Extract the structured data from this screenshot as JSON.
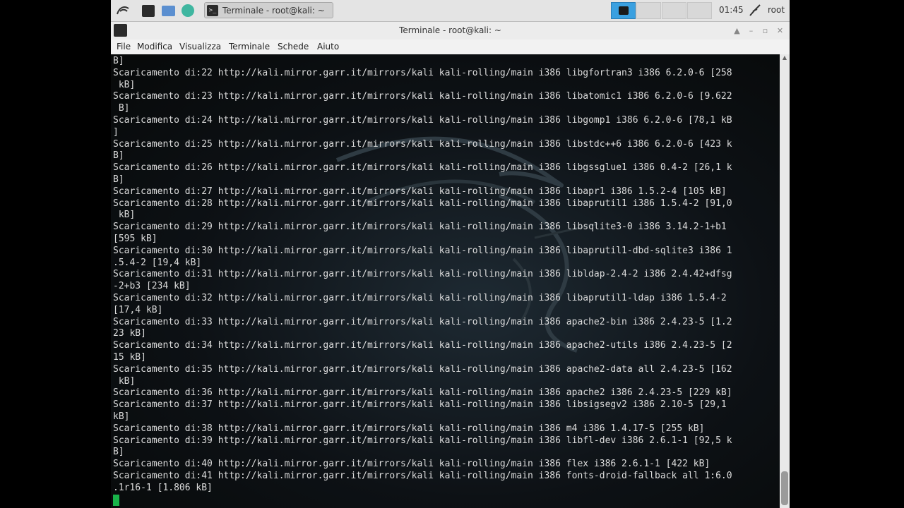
{
  "panel": {
    "task_label": "Terminale - root@kali: ~",
    "clock": "01:45",
    "user": "root"
  },
  "window": {
    "title": "Terminale - root@kali: ~",
    "menus": [
      "File",
      "Modifica",
      "Visualizza",
      "Terminale",
      "Schede",
      "Aiuto"
    ]
  },
  "terminal": {
    "lines": [
      "B]",
      "Scaricamento di:22 http://kali.mirror.garr.it/mirrors/kali kali-rolling/main i386 libgfortran3 i386 6.2.0-6 [258",
      " kB]",
      "Scaricamento di:23 http://kali.mirror.garr.it/mirrors/kali kali-rolling/main i386 libatomic1 i386 6.2.0-6 [9.622",
      " B]",
      "Scaricamento di:24 http://kali.mirror.garr.it/mirrors/kali kali-rolling/main i386 libgomp1 i386 6.2.0-6 [78,1 kB",
      "]",
      "Scaricamento di:25 http://kali.mirror.garr.it/mirrors/kali kali-rolling/main i386 libstdc++6 i386 6.2.0-6 [423 k",
      "B]",
      "Scaricamento di:26 http://kali.mirror.garr.it/mirrors/kali kali-rolling/main i386 libgssglue1 i386 0.4-2 [26,1 k",
      "B]",
      "Scaricamento di:27 http://kali.mirror.garr.it/mirrors/kali kali-rolling/main i386 libapr1 i386 1.5.2-4 [105 kB]",
      "Scaricamento di:28 http://kali.mirror.garr.it/mirrors/kali kali-rolling/main i386 libaprutil1 i386 1.5.4-2 [91,0",
      " kB]",
      "Scaricamento di:29 http://kali.mirror.garr.it/mirrors/kali kali-rolling/main i386 libsqlite3-0 i386 3.14.2-1+b1",
      "[595 kB]",
      "Scaricamento di:30 http://kali.mirror.garr.it/mirrors/kali kali-rolling/main i386 libaprutil1-dbd-sqlite3 i386 1",
      ".5.4-2 [19,4 kB]",
      "Scaricamento di:31 http://kali.mirror.garr.it/mirrors/kali kali-rolling/main i386 libldap-2.4-2 i386 2.4.42+dfsg",
      "-2+b3 [234 kB]",
      "Scaricamento di:32 http://kali.mirror.garr.it/mirrors/kali kali-rolling/main i386 libaprutil1-ldap i386 1.5.4-2",
      "[17,4 kB]",
      "Scaricamento di:33 http://kali.mirror.garr.it/mirrors/kali kali-rolling/main i386 apache2-bin i386 2.4.23-5 [1.2",
      "23 kB]",
      "Scaricamento di:34 http://kali.mirror.garr.it/mirrors/kali kali-rolling/main i386 apache2-utils i386 2.4.23-5 [2",
      "15 kB]",
      "Scaricamento di:35 http://kali.mirror.garr.it/mirrors/kali kali-rolling/main i386 apache2-data all 2.4.23-5 [162",
      " kB]",
      "Scaricamento di:36 http://kali.mirror.garr.it/mirrors/kali kali-rolling/main i386 apache2 i386 2.4.23-5 [229 kB]",
      "Scaricamento di:37 http://kali.mirror.garr.it/mirrors/kali kali-rolling/main i386 libsigsegv2 i386 2.10-5 [29,1",
      "kB]",
      "Scaricamento di:38 http://kali.mirror.garr.it/mirrors/kali kali-rolling/main i386 m4 i386 1.4.17-5 [255 kB]",
      "Scaricamento di:39 http://kali.mirror.garr.it/mirrors/kali kali-rolling/main i386 libfl-dev i386 2.6.1-1 [92,5 k",
      "B]",
      "Scaricamento di:40 http://kali.mirror.garr.it/mirrors/kali kali-rolling/main i386 flex i386 2.6.1-1 [422 kB]",
      "Scaricamento di:41 http://kali.mirror.garr.it/mirrors/kali kali-rolling/main i386 fonts-droid-fallback all 1:6.0",
      ".1r16-1 [1.806 kB]"
    ]
  }
}
